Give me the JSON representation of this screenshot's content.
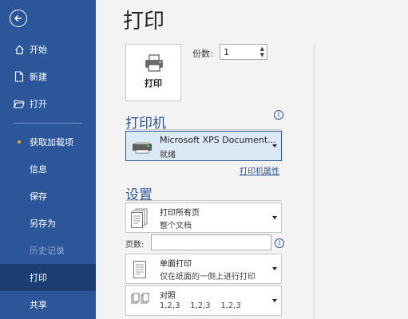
{
  "sidebar": {
    "items": [
      {
        "label": "开始"
      },
      {
        "label": "新建"
      },
      {
        "label": "打开"
      },
      {
        "label": "获取加载项"
      },
      {
        "label": "信息"
      },
      {
        "label": "保存"
      },
      {
        "label": "另存为"
      },
      {
        "label": "历史记录"
      },
      {
        "label": "打印"
      },
      {
        "label": "共享"
      }
    ]
  },
  "main": {
    "title": "打印",
    "print_button_label": "打印",
    "copies_label": "份数:",
    "copies_value": "1",
    "printer_section": {
      "title": "打印机",
      "info_icon": "i",
      "printer_name": "Microsoft XPS Document...",
      "printer_status": "就绪",
      "properties_link": "打印机属性"
    },
    "settings_section": {
      "title": "设置",
      "scope": {
        "line1": "打印所有页",
        "line2": "整个文档"
      },
      "pages_label": "页数:",
      "pages_value": "",
      "sides": {
        "line1": "单面打印",
        "line2": "仅在纸面的一侧上进行打印"
      },
      "collate": {
        "line1": "对照",
        "line2": "1,2,3    1,2,3    1,2,3"
      }
    }
  },
  "colors": {
    "sidebar_bg": "#2b579a",
    "active_bg": "#1b3d72",
    "accent": "#2b579a",
    "dot": "#f0a030"
  }
}
